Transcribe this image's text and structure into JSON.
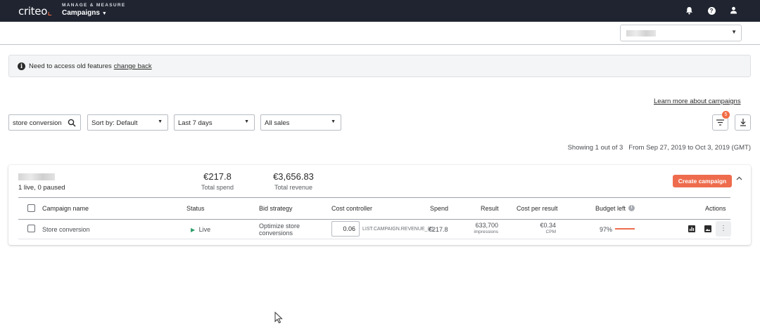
{
  "topbar": {
    "logo": "criteo",
    "section_label": "MANAGE & MEASURE",
    "section_title": "Campaigns"
  },
  "banner": {
    "message": "Need to access old features",
    "link": "change back"
  },
  "learn_more": "Learn more about campaigns",
  "filters": {
    "search_value": "store conversion",
    "sort": "Sort by: Default",
    "date_range": "Last 7 days",
    "sales": "All sales",
    "filter_count": "5"
  },
  "showing": {
    "count": "Showing 1 out of 3",
    "range": "From Sep 27, 2019 to Oct 3, 2019 (GMT)"
  },
  "card": {
    "status_summary": "1 live, 0 paused",
    "total_spend_value": "€217.8",
    "total_spend_label": "Total spend",
    "total_revenue_value": "€3,656.83",
    "total_revenue_label": "Total revenue",
    "create_button": "Create campaign"
  },
  "table": {
    "headers": {
      "campaign_name": "Campaign name",
      "status": "Status",
      "bid_strategy": "Bid strategy",
      "cost_controller": "Cost controller",
      "spend": "Spend",
      "result": "Result",
      "cost_per_result": "Cost per result",
      "budget_left": "Budget left",
      "actions": "Actions"
    },
    "rows": [
      {
        "name": "Store conversion",
        "status": "Live",
        "bid_strategy_line1": "Optimize store",
        "bid_strategy_line2": "conversions",
        "cost_value": "0.06",
        "cost_label": "LIST.CAMPAIGN.REVENUE_(€)",
        "spend": "€217.8",
        "result": "633,700",
        "result_unit": "impressions",
        "cpr": "€0.34",
        "cpr_unit": "CPM",
        "budget_left": "97%"
      }
    ]
  },
  "colors": {
    "topbar": "#1f2430",
    "accent": "#ee6c4d",
    "live": "#2e9e6b"
  }
}
